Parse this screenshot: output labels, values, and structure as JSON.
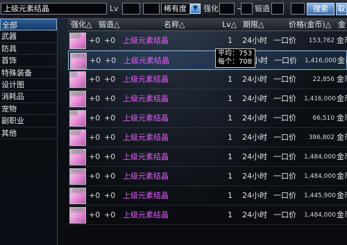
{
  "search": {
    "keyword": "上级元素结晶",
    "lv_label": "Lv",
    "rarity_value": "稀有度",
    "enhance_label": "强化",
    "forge_label": "锻造",
    "search_button": "搜索",
    "close_button": "取消"
  },
  "categories": [
    {
      "label": "全部",
      "selected": true
    },
    {
      "label": "武器"
    },
    {
      "label": "防具"
    },
    {
      "label": "首饰"
    },
    {
      "label": "特殊装备"
    },
    {
      "label": "设计图"
    },
    {
      "label": "消耗品"
    },
    {
      "label": "宠物"
    },
    {
      "label": "副职业"
    },
    {
      "label": "其他"
    }
  ],
  "table": {
    "headers": {
      "enhance": "强化△",
      "forge": "锻造△",
      "name": "名称△",
      "lv": "Lv△",
      "duration": "期限△",
      "price": "价格(金币)△",
      "currency": "金"
    },
    "rows": [
      {
        "count": "226",
        "enh": "+0",
        "forge": "+0",
        "name": "上级元素结晶",
        "lv": "1",
        "time": "24小时",
        "type": "一口价",
        "price": "153,782",
        "cur": "金币"
      },
      {
        "count": "2000",
        "enh": "+0",
        "forge": "+0",
        "name": "上级元素结晶",
        "lv": "1",
        "time": "24小时",
        "type": "一口价",
        "price": "1,416,000",
        "cur": "金币"
      },
      {
        "count": "32",
        "enh": "+0",
        "forge": "+0",
        "name": "上级元素结晶",
        "lv": "1",
        "time": "24小时",
        "type": "一口价",
        "price": "22,856",
        "cur": "金币"
      },
      {
        "count": "2000",
        "enh": "+0",
        "forge": "+0",
        "name": "上级元素结晶",
        "lv": "1",
        "time": "24小时",
        "type": "一口价",
        "price": "1,416,000",
        "cur": "金币"
      },
      {
        "count": "90",
        "enh": "+0",
        "forge": "+0",
        "name": "上级元素结晶",
        "lv": "1",
        "time": "24小时",
        "type": "一口价",
        "price": "66,510",
        "cur": "金币"
      },
      {
        "count": "522",
        "enh": "+0",
        "forge": "+0",
        "name": "上级元素结晶",
        "lv": "1",
        "time": "24小时",
        "type": "一口价",
        "price": "386,802",
        "cur": "金币"
      },
      {
        "count": "2000",
        "enh": "+0",
        "forge": "+0",
        "name": "上级元素结晶",
        "lv": "1",
        "time": "24小时",
        "type": "一口价",
        "price": "1,484,000",
        "cur": "金币"
      },
      {
        "count": "2000",
        "enh": "+0",
        "forge": "+0",
        "name": "上级元素结晶",
        "lv": "1",
        "time": "24小时",
        "type": "一口价",
        "price": "1,484,000",
        "cur": "金币"
      },
      {
        "count": "1950",
        "enh": "+0",
        "forge": "+0",
        "name": "上级元素结晶",
        "lv": "1",
        "time": "24小时",
        "type": "一口价",
        "price": "1,445,900",
        "cur": "金币"
      },
      {
        "count": "2000",
        "enh": "+0",
        "forge": "+0",
        "name": "上级元素结晶",
        "lv": "1",
        "time": "24小时",
        "type": "一口价",
        "price": "1,484,000",
        "cur": "金币"
      }
    ]
  },
  "tooltip": {
    "avg": "平均：753",
    "each": "每个：708"
  },
  "colors": {
    "item_name": "#e65cff",
    "selection": "#7fb6f0"
  }
}
